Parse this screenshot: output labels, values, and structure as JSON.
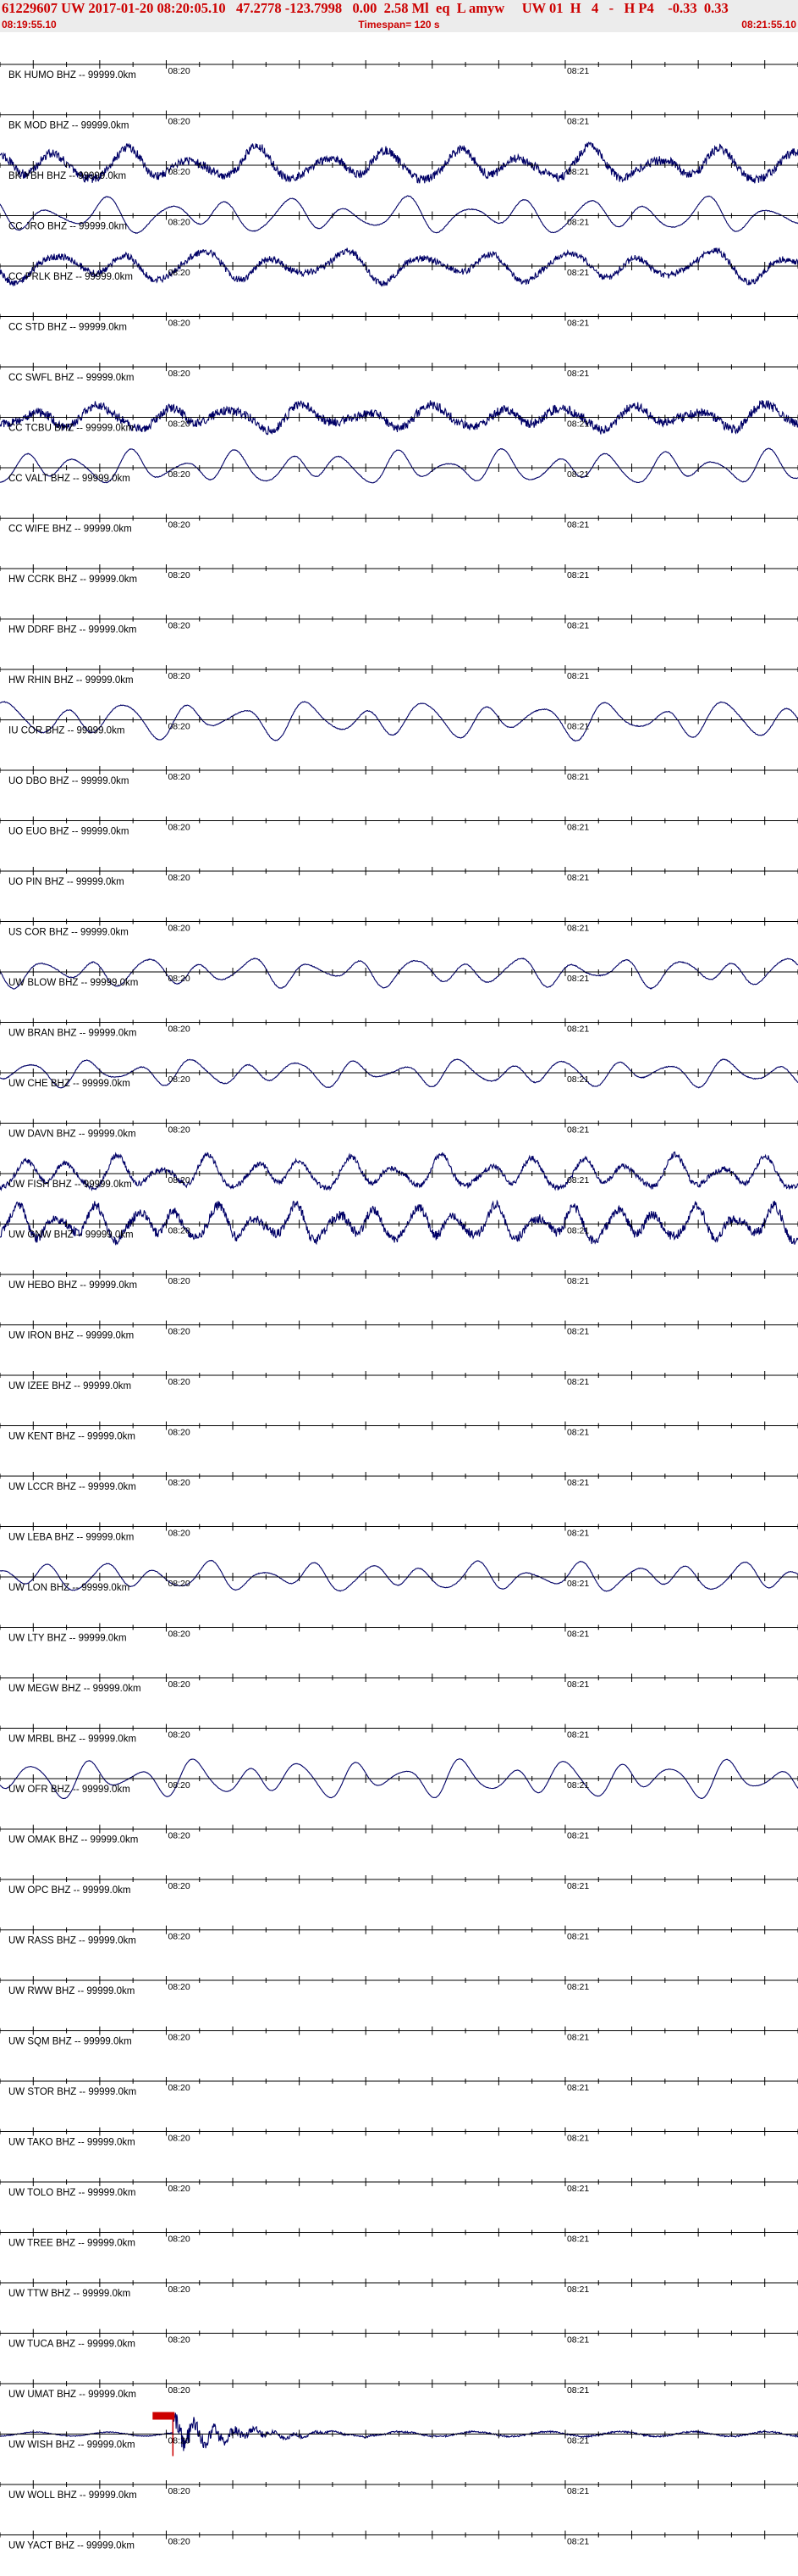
{
  "header": {
    "title": "61229607 UW 2017-01-20 08:20:05.10   47.2778 -123.7998   0.00  2.58 Ml  eq  L amyw     UW 01  H   4   -   H P4    -0.33  0.33",
    "start_time": "08:19:55.10",
    "timespan": "Timespan= 120 s",
    "end_time": "08:21:55.10"
  },
  "colors": {
    "title_red": "#cc0000",
    "trace_blue": "#000066",
    "axis_black": "#000000",
    "pick_red": "#cc0000"
  },
  "chart_data": {
    "type": "line",
    "title": "61229607 UW 2017-01-20 08:20:05.10   47.2778 -123.7998   0.00  2.58 Ml  eq  L amyw",
    "x_range_s": [
      0,
      120
    ],
    "time_ticks": [
      {
        "t": 25,
        "label": "08:20"
      },
      {
        "t": 85,
        "label": "08:21"
      }
    ],
    "channels": [
      {
        "name": "BK HUMO BHZ -- 99999.0km",
        "trace": false
      },
      {
        "name": "BK MOD BHZ -- 99999.0km",
        "trace": false
      },
      {
        "name": "BK YBH BHZ -- 99999.0km",
        "trace": true,
        "style": "band",
        "amp": 0.8,
        "period": 10,
        "noise": 0.25
      },
      {
        "name": "CC JRO BHZ -- 99999.0km",
        "trace": true,
        "style": "smooth",
        "amp": 0.85,
        "period": 9,
        "noise": 0.02
      },
      {
        "name": "CC PRLK BHZ -- 99999.0km",
        "trace": true,
        "style": "band",
        "amp": 0.75,
        "period": 11,
        "noise": 0.2
      },
      {
        "name": "CC STD BHZ -- 99999.0km",
        "trace": false
      },
      {
        "name": "CC SWFL BHZ -- 99999.0km",
        "trace": false
      },
      {
        "name": "CC TCBU BHZ -- 99999.0km",
        "trace": true,
        "style": "band",
        "amp": 0.6,
        "period": 10,
        "noise": 0.35
      },
      {
        "name": "CC VALT BHZ -- 99999.0km",
        "trace": true,
        "style": "smooth",
        "amp": 0.8,
        "period": 8,
        "noise": 0.02
      },
      {
        "name": "CC WIFE BHZ -- 99999.0km",
        "trace": false
      },
      {
        "name": "HW CCRK BHZ -- 99999.0km",
        "trace": false
      },
      {
        "name": "HW DDRF BHZ -- 99999.0km",
        "trace": false
      },
      {
        "name": "HW RHIN BHZ -- 99999.0km",
        "trace": false
      },
      {
        "name": "IU COR BHZ -- 99999.0km",
        "trace": true,
        "style": "smooth",
        "amp": 0.9,
        "period": 9,
        "noise": 0.02
      },
      {
        "name": "UO DBO BHZ -- 99999.0km",
        "trace": false
      },
      {
        "name": "UO EUO BHZ -- 99999.0km",
        "trace": false
      },
      {
        "name": "UO PIN BHZ -- 99999.0km",
        "trace": false
      },
      {
        "name": "US COR BHZ -- 99999.0km",
        "trace": false
      },
      {
        "name": "UW BLOW BHZ -- 99999.0km",
        "trace": true,
        "style": "smooth",
        "amp": 0.7,
        "period": 8,
        "noise": 0.03
      },
      {
        "name": "UW BRAN BHZ -- 99999.0km",
        "trace": false
      },
      {
        "name": "UW CHE BHZ -- 99999.0km",
        "trace": true,
        "style": "smooth",
        "amp": 0.65,
        "period": 8,
        "noise": 0.03
      },
      {
        "name": "UW DAVN BHZ -- 99999.0km",
        "trace": false
      },
      {
        "name": "UW FISH BHZ -- 99999.0km",
        "trace": true,
        "style": "band",
        "amp": 0.8,
        "period": 7,
        "noise": 0.15
      },
      {
        "name": "UW GNW BHZ -- 99999.0km",
        "trace": true,
        "style": "band",
        "amp": 0.85,
        "period": 6,
        "noise": 0.25
      },
      {
        "name": "UW HEBO BHZ -- 99999.0km",
        "trace": false
      },
      {
        "name": "UW IRON BHZ -- 99999.0km",
        "trace": false
      },
      {
        "name": "UW IZEE BHZ -- 99999.0km",
        "trace": false
      },
      {
        "name": "UW KENT BHZ -- 99999.0km",
        "trace": false
      },
      {
        "name": "UW LCCR BHZ -- 99999.0km",
        "trace": false
      },
      {
        "name": "UW LEBA BHZ -- 99999.0km",
        "trace": false
      },
      {
        "name": "UW LON BHZ -- 99999.0km",
        "trace": true,
        "style": "smooth",
        "amp": 0.7,
        "period": 8,
        "noise": 0.02
      },
      {
        "name": "UW LTY BHZ -- 99999.0km",
        "trace": false
      },
      {
        "name": "UW MEGW BHZ -- 99999.0km",
        "trace": false
      },
      {
        "name": "UW MRBL BHZ -- 99999.0km",
        "trace": false
      },
      {
        "name": "UW OFR BHZ -- 99999.0km",
        "trace": true,
        "style": "smooth",
        "amp": 0.9,
        "period": 8,
        "noise": 0.01
      },
      {
        "name": "UW OMAK BHZ -- 99999.0km",
        "trace": false
      },
      {
        "name": "UW OPC BHZ -- 99999.0km",
        "trace": false
      },
      {
        "name": "UW RASS BHZ -- 99999.0km",
        "trace": false
      },
      {
        "name": "UW RWW BHZ -- 99999.0km",
        "trace": false
      },
      {
        "name": "UW SQM BHZ -- 99999.0km",
        "trace": false
      },
      {
        "name": "UW STOR BHZ -- 99999.0km",
        "trace": false
      },
      {
        "name": "UW TAKO BHZ -- 99999.0km",
        "trace": false
      },
      {
        "name": "UW TOLO BHZ -- 99999.0km",
        "trace": false
      },
      {
        "name": "UW TREE BHZ -- 99999.0km",
        "trace": false
      },
      {
        "name": "UW TTW BHZ -- 99999.0km",
        "trace": false
      },
      {
        "name": "UW TUCA BHZ -- 99999.0km",
        "trace": false
      },
      {
        "name": "UW UMAT BHZ -- 99999.0km",
        "trace": false
      },
      {
        "name": "UW WISH BHZ -- 99999.0km",
        "trace": true,
        "style": "event",
        "amp": 0.9,
        "period": 3,
        "noise": 0.05,
        "onset_s": 26
      },
      {
        "name": "UW WOLL BHZ -- 99999.0km",
        "trace": false
      },
      {
        "name": "UW YACT BHZ -- 99999.0km",
        "trace": false
      }
    ]
  }
}
